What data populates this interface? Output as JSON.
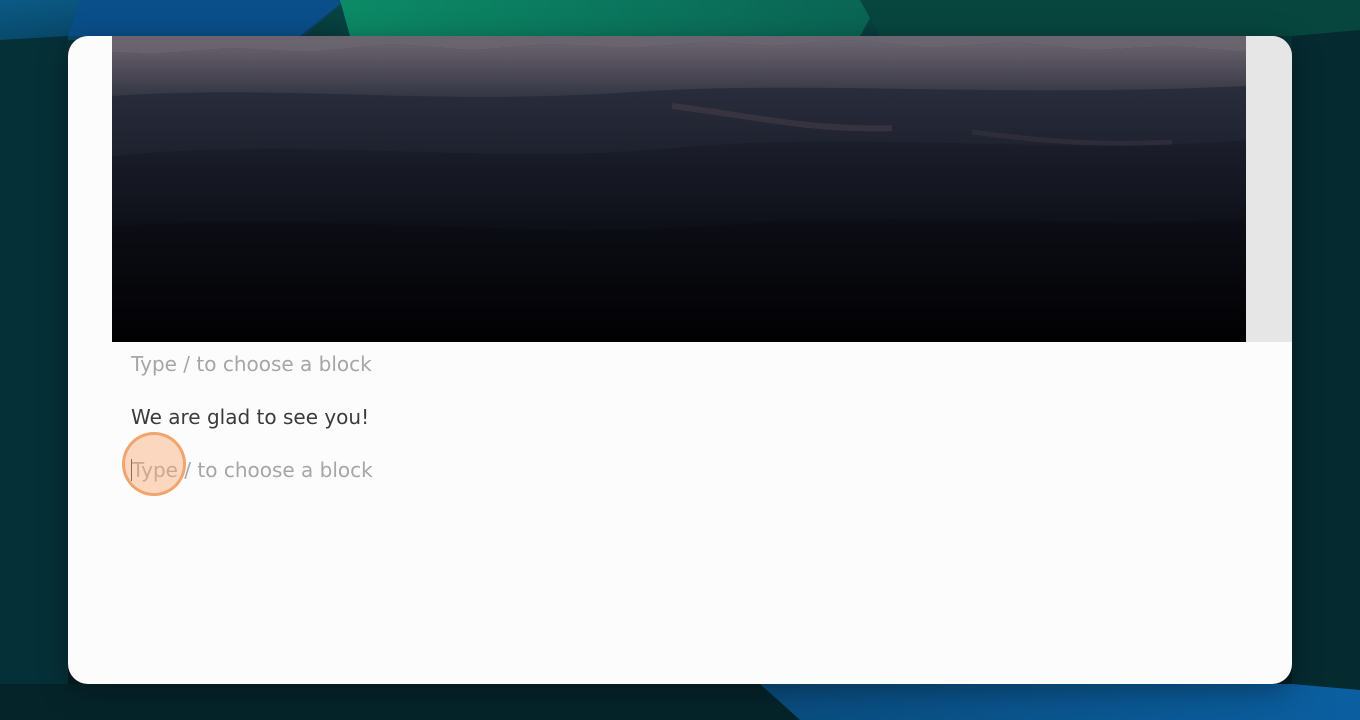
{
  "editor": {
    "blocks": [
      {
        "type": "placeholder",
        "text": "Type / to choose a block"
      },
      {
        "type": "paragraph",
        "text": "We are glad to see you!"
      },
      {
        "type": "placeholder",
        "text": "Type / to choose a block",
        "focused": true
      }
    ]
  },
  "cover_image": {
    "subject": "dark forested mountain valley at dusk"
  },
  "colors": {
    "window_background": "#fcfcfc",
    "placeholder_text": "#a6a6a6",
    "body_text": "#3b3b3b",
    "click_indicator": "#eea064",
    "wallpaper_teal": "#06292e"
  }
}
